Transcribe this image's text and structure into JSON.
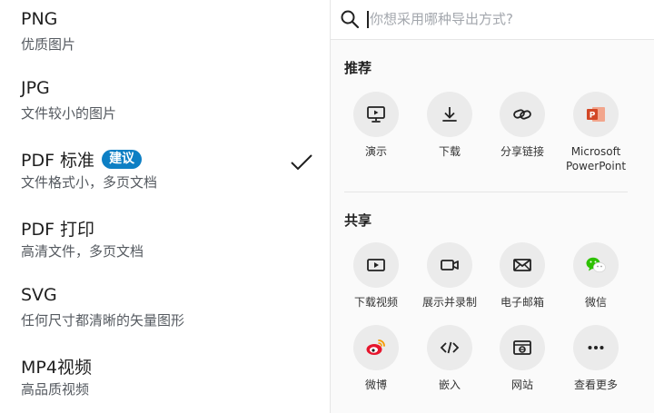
{
  "formats": [
    {
      "name": "PNG",
      "desc": "优质图片"
    },
    {
      "name": "JPG",
      "desc": "文件较小的图片"
    },
    {
      "name": "PDF 标准",
      "desc": "文件格式小，多页文档",
      "badge": "建议",
      "selected": true
    },
    {
      "name": "PDF 打印",
      "desc": "高清文件，多页文档"
    },
    {
      "name": "SVG",
      "desc": "任何尺寸都清晰的矢量图形"
    },
    {
      "name": "MP4视频",
      "desc": "高品质视频"
    }
  ],
  "search": {
    "placeholder": "你想采用哪种导出方式?"
  },
  "recommend": {
    "title": "推荐",
    "items": [
      {
        "label": "演示",
        "icon": "present-icon"
      },
      {
        "label": "下载",
        "icon": "download-icon"
      },
      {
        "label": "分享链接",
        "icon": "link-icon"
      },
      {
        "label": "Microsoft PowerPoint",
        "icon": "powerpoint-icon"
      }
    ]
  },
  "share": {
    "title": "共享",
    "items": [
      {
        "label": "下载视频",
        "icon": "video-play-icon"
      },
      {
        "label": "展示并录制",
        "icon": "camera-icon"
      },
      {
        "label": "电子邮箱",
        "icon": "mail-icon"
      },
      {
        "label": "微信",
        "icon": "wechat-icon"
      },
      {
        "label": "微博",
        "icon": "weibo-icon"
      },
      {
        "label": "嵌入",
        "icon": "embed-code-icon"
      },
      {
        "label": "网站",
        "icon": "website-icon"
      },
      {
        "label": "查看更多",
        "icon": "more-icon"
      }
    ]
  },
  "colors": {
    "badge": "#0d7fc4",
    "powerpoint": "#d24726",
    "wechat": "#2dc100",
    "weibo": "#e6162d"
  }
}
